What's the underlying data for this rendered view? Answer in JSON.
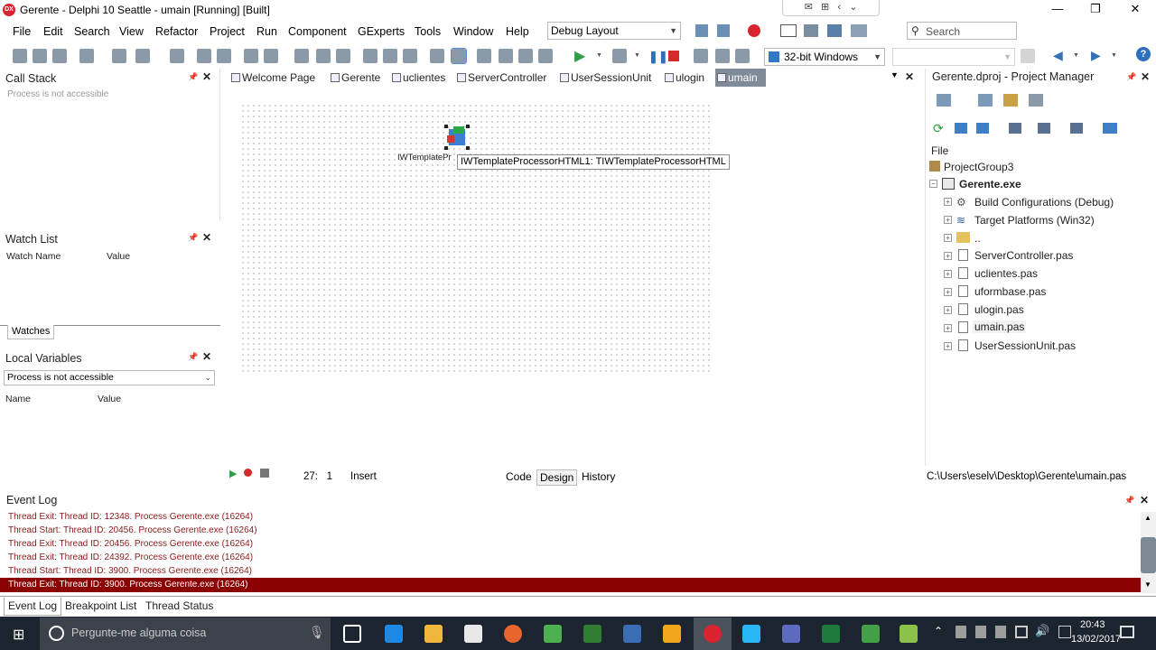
{
  "window": {
    "title": "Gerente - Delphi 10 Seattle - umain [Running] [Built]",
    "app_icon_label": "DX"
  },
  "menu": [
    "File",
    "Edit",
    "Search",
    "View",
    "Refactor",
    "Project",
    "Run",
    "Component",
    "GExperts",
    "Tools",
    "Window",
    "Help"
  ],
  "toolbar": {
    "layout_combo": "Debug Layout",
    "search_placeholder": "Search",
    "platform_combo": "32-bit Windows"
  },
  "call_stack": {
    "title": "Call Stack",
    "message": "Process is not accessible"
  },
  "watch_list": {
    "title": "Watch List",
    "col_name": "Watch Name",
    "col_value": "Value",
    "tab": "Watches"
  },
  "local_vars": {
    "title": "Local Variables",
    "combo": "Process is not accessible",
    "col_name": "Name",
    "col_value": "Value"
  },
  "editor_tabs": [
    "Welcome Page",
    "Gerente",
    "uclientes",
    "ServerController",
    "UserSessionUnit",
    "ulogin",
    "umain"
  ],
  "designer": {
    "component_caption": "IWTemplatePr",
    "hint": "IWTemplateProcessorHTML1: TIWTemplateProcessorHTML"
  },
  "status": {
    "position": "27:   1",
    "mode": "Insert",
    "tabs": [
      "Code",
      "Design",
      "History"
    ],
    "path": "C:\\Users\\eselv\\Desktop\\Gerente\\umain.pas"
  },
  "project_manager": {
    "title": "Gerente.dproj - Project Manager",
    "file_label": "File",
    "group": "ProjectGroup3",
    "project": "Gerente.exe",
    "items": [
      "Build Configurations (Debug)",
      "Target Platforms (Win32)",
      "..",
      "ServerController.pas",
      "uclientes.pas",
      "uformbase.pas",
      "ulogin.pas",
      "umain.pas",
      "UserSessionUnit.pas"
    ]
  },
  "event_log": {
    "title": "Event Log",
    "lines": [
      "Thread Exit: Thread ID: 12348. Process Gerente.exe (16264)",
      "Thread Start: Thread ID: 20456. Process Gerente.exe (16264)",
      "Thread Exit: Thread ID: 20456. Process Gerente.exe (16264)",
      "Thread Exit: Thread ID: 24392. Process Gerente.exe (16264)",
      "Thread Start: Thread ID: 3900. Process Gerente.exe (16264)",
      "Thread Exit: Thread ID: 3900. Process Gerente.exe (16264)"
    ],
    "bottom_tabs": [
      "Event Log",
      "Breakpoint List",
      "Thread Status"
    ]
  },
  "taskbar": {
    "search_placeholder": "Pergunte-me alguma coisa",
    "time": "20:43",
    "date": "13/02/2017"
  },
  "colors": {
    "selected_log": "#8b0000",
    "log_text": "#8b1a1a",
    "active_tab": "#7f8b98",
    "taskbar": "#1c2430"
  }
}
